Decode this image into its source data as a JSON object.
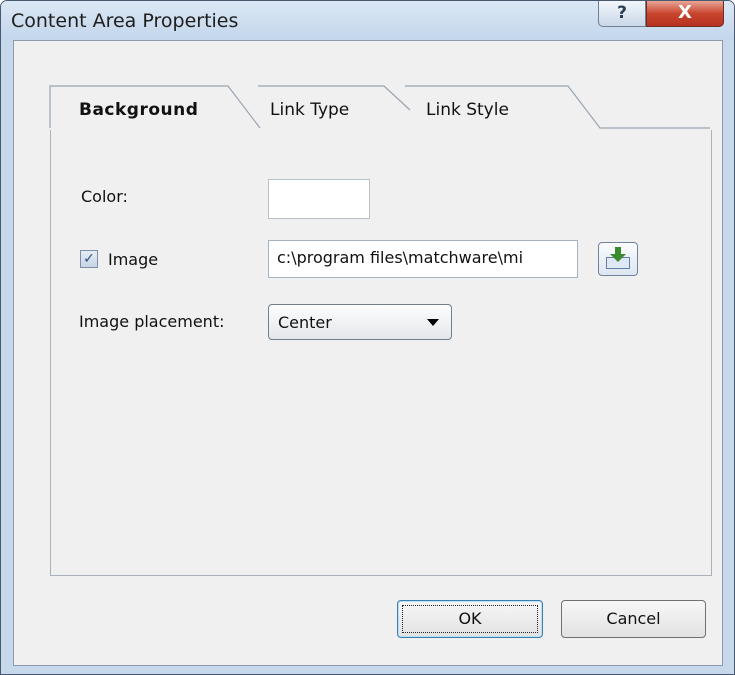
{
  "window": {
    "title": "Content Area Properties",
    "help_label": "?",
    "close_label": "X"
  },
  "tabs": [
    {
      "label": "Background",
      "active": true
    },
    {
      "label": "Link Type",
      "active": false
    },
    {
      "label": "Link Style",
      "active": false
    }
  ],
  "background": {
    "color_label": "Color:",
    "color_value": "#ffffff",
    "image_label": "Image",
    "image_checked": true,
    "image_path": "c:\\program files\\matchware\\mi",
    "placement_label": "Image placement:",
    "placement_value": "Center"
  },
  "buttons": {
    "ok": "OK",
    "cancel": "Cancel"
  },
  "icons": {
    "browse": "open-image-icon",
    "check": "checkmark-icon",
    "dropdown": "chevron-down-icon"
  }
}
